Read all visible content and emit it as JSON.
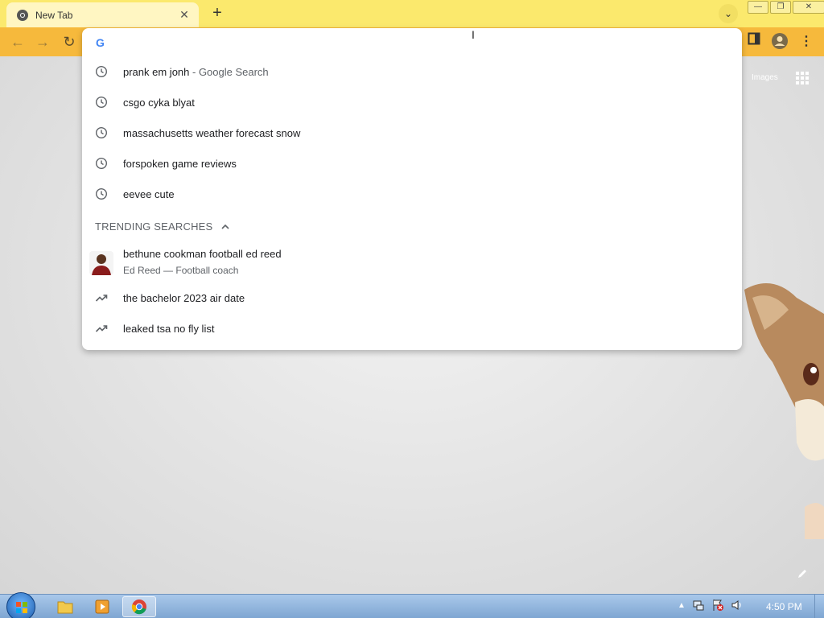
{
  "browser": {
    "tab": {
      "title": "New Tab",
      "close": "✕"
    },
    "new_tab": "+",
    "tab_search": "⌄",
    "window": {
      "minimize": "—",
      "maximize": "❐",
      "close": "✕"
    }
  },
  "page": {
    "images_link": "Images"
  },
  "omnibox": {
    "value": "",
    "history": [
      {
        "text": "prank em jonh",
        "suffix": " - Google Search"
      },
      {
        "text": "csgo cyka blyat",
        "suffix": ""
      },
      {
        "text": "massachusetts weather forecast snow",
        "suffix": ""
      },
      {
        "text": "forspoken game reviews",
        "suffix": ""
      },
      {
        "text": "eevee cute",
        "suffix": ""
      }
    ],
    "trending_header": "TRENDING SEARCHES",
    "trending_entity": {
      "title": "bethune cookman football ed reed",
      "subtitle": "Ed Reed — Football coach"
    },
    "trending": [
      "the bachelor 2023 air date",
      "leaked tsa no fly list"
    ]
  },
  "taskbar": {
    "clock": "4:50 PM"
  },
  "colors": {
    "tab_bar": "#fbe96d",
    "toolbar": "#f6b93c",
    "google_blue": "#4285f4"
  }
}
